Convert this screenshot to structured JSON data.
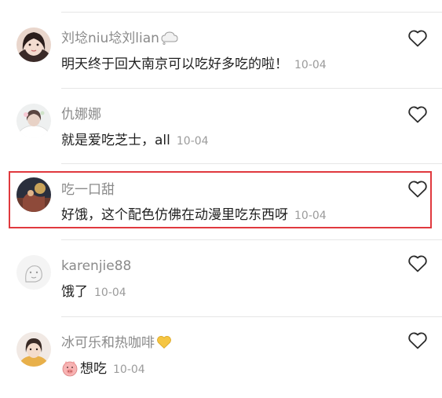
{
  "comments": [
    {
      "username": "刘埝niu埝刘lian",
      "username_tag_icon": "cloud-bubble-icon",
      "text": "明天终于回大南京可以吃好多吃的啦！",
      "date": "10-04",
      "liked": false
    },
    {
      "username": "仇娜娜",
      "text": "就是爱吃芝士，all",
      "date": "10-04",
      "liked": false
    },
    {
      "username": "吃一口甜",
      "text": "好饿，这个配色仿佛在动漫里吃东西呀",
      "date": "10-04",
      "liked": false,
      "highlighted": true
    },
    {
      "username": "karenjie88",
      "text": "饿了",
      "date": "10-04",
      "liked": false
    },
    {
      "username": "冰可乐和热咖啡",
      "username_tag_icon": "yellow-heart-icon",
      "text_prefix_icon": "pig-face-emoji",
      "text": "想吃",
      "date": "10-04",
      "liked": false
    }
  ],
  "colors": {
    "highlight_border": "#e0393e",
    "username": "#8a8a8a",
    "body_text": "#1f1f1f",
    "date": "#9b9b9b",
    "divider": "#e6e6e6"
  }
}
